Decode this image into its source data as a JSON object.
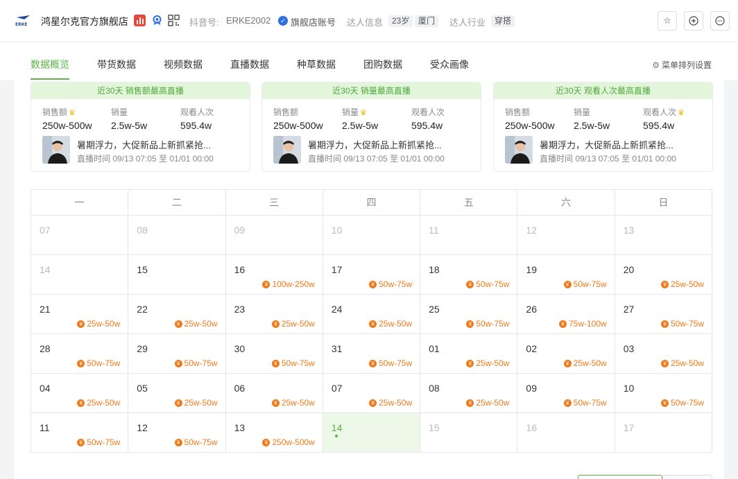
{
  "header": {
    "shop_name": "鸿星尔克官方旗舰店",
    "douyin_label": "抖音号:",
    "douyin_id": "ERKE2002",
    "flagship_label": "旗舰店账号",
    "talent_info_label": "达人信息",
    "age": "23岁",
    "city": "厦门",
    "industry_label": "达人行业",
    "industry": "穿搭"
  },
  "tabs": [
    {
      "label": "数据概览",
      "active": true
    },
    {
      "label": "带货数据"
    },
    {
      "label": "视频数据"
    },
    {
      "label": "直播数据"
    },
    {
      "label": "种草数据"
    },
    {
      "label": "团购数据"
    },
    {
      "label": "受众画像"
    }
  ],
  "menu_settings_label": "菜单排列设置",
  "cards": [
    {
      "title": "近30天 销售额最高直播",
      "metrics": [
        {
          "label": "销售额",
          "value": "250w-500w",
          "crown": true
        },
        {
          "label": "销量",
          "value": "2.5w-5w",
          "crown": false
        },
        {
          "label": "观看人次",
          "value": "595.4w",
          "crown": false
        }
      ],
      "live_title": "暑期浮力，大促新品上新抓紧抢...",
      "live_time": "直播时间 09/13 07:05 至 01/01 00:00"
    },
    {
      "title": "近30天 销量最高直播",
      "metrics": [
        {
          "label": "销售额",
          "value": "250w-500w",
          "crown": false
        },
        {
          "label": "销量",
          "value": "2.5w-5w",
          "crown": true
        },
        {
          "label": "观看人次",
          "value": "595.4w",
          "crown": false
        }
      ],
      "live_title": "暑期浮力，大促新品上新抓紧抢...",
      "live_time": "直播时间 09/13 07:05 至 01/01 00:00"
    },
    {
      "title": "近30天 观看人次最高直播",
      "metrics": [
        {
          "label": "销售额",
          "value": "250w-500w",
          "crown": false
        },
        {
          "label": "销量",
          "value": "2.5w-5w",
          "crown": false
        },
        {
          "label": "观看人次",
          "value": "595.4w",
          "crown": true
        }
      ],
      "live_title": "暑期浮力，大促新品上新抓紧抢...",
      "live_time": "直播时间 09/13 07:05 至 01/01 00:00"
    }
  ],
  "calendar": {
    "weekdays": [
      "一",
      "二",
      "三",
      "四",
      "五",
      "六",
      "日"
    ],
    "weeks": [
      [
        {
          "d": "07",
          "m": true
        },
        {
          "d": "08",
          "m": true
        },
        {
          "d": "09",
          "m": true
        },
        {
          "d": "10",
          "m": true
        },
        {
          "d": "11",
          "m": true
        },
        {
          "d": "12",
          "m": true
        },
        {
          "d": "13",
          "m": true
        }
      ],
      [
        {
          "d": "14",
          "m": true
        },
        {
          "d": "15"
        },
        {
          "d": "16",
          "s": "100w-250w"
        },
        {
          "d": "17",
          "s": "50w-75w"
        },
        {
          "d": "18",
          "s": "50w-75w"
        },
        {
          "d": "19",
          "s": "50w-75w"
        },
        {
          "d": "20",
          "s": "25w-50w"
        }
      ],
      [
        {
          "d": "21",
          "s": "25w-50w"
        },
        {
          "d": "22",
          "s": "25w-50w"
        },
        {
          "d": "23",
          "s": "25w-50w"
        },
        {
          "d": "24",
          "s": "25w-50w"
        },
        {
          "d": "25",
          "s": "50w-75w"
        },
        {
          "d": "26",
          "s": "75w-100w"
        },
        {
          "d": "27",
          "s": "50w-75w"
        }
      ],
      [
        {
          "d": "28",
          "s": "50w-75w"
        },
        {
          "d": "29",
          "s": "50w-75w"
        },
        {
          "d": "30",
          "s": "50w-75w"
        },
        {
          "d": "31",
          "s": "50w-75w"
        },
        {
          "d": "01",
          "s": "25w-50w"
        },
        {
          "d": "02",
          "s": "25w-50w"
        },
        {
          "d": "03",
          "s": "25w-50w"
        }
      ],
      [
        {
          "d": "04",
          "s": "25w-50w"
        },
        {
          "d": "05",
          "s": "25w-50w"
        },
        {
          "d": "06",
          "s": "25w-50w"
        },
        {
          "d": "07",
          "s": "25w-50w"
        },
        {
          "d": "08",
          "s": "25w-50w"
        },
        {
          "d": "09",
          "s": "50w-75w"
        },
        {
          "d": "10",
          "s": "50w-75w"
        }
      ],
      [
        {
          "d": "11",
          "s": "50w-75w"
        },
        {
          "d": "12",
          "s": "50w-75w"
        },
        {
          "d": "13",
          "s": "250w-500w"
        },
        {
          "d": "14",
          "today": true
        },
        {
          "d": "15",
          "m": true
        },
        {
          "d": "16",
          "m": true
        },
        {
          "d": "17",
          "m": true
        }
      ]
    ]
  },
  "colors": {
    "accent": "#5ab342",
    "sales": "#f07a1a",
    "card_title_bg": "#e3f6dc"
  }
}
